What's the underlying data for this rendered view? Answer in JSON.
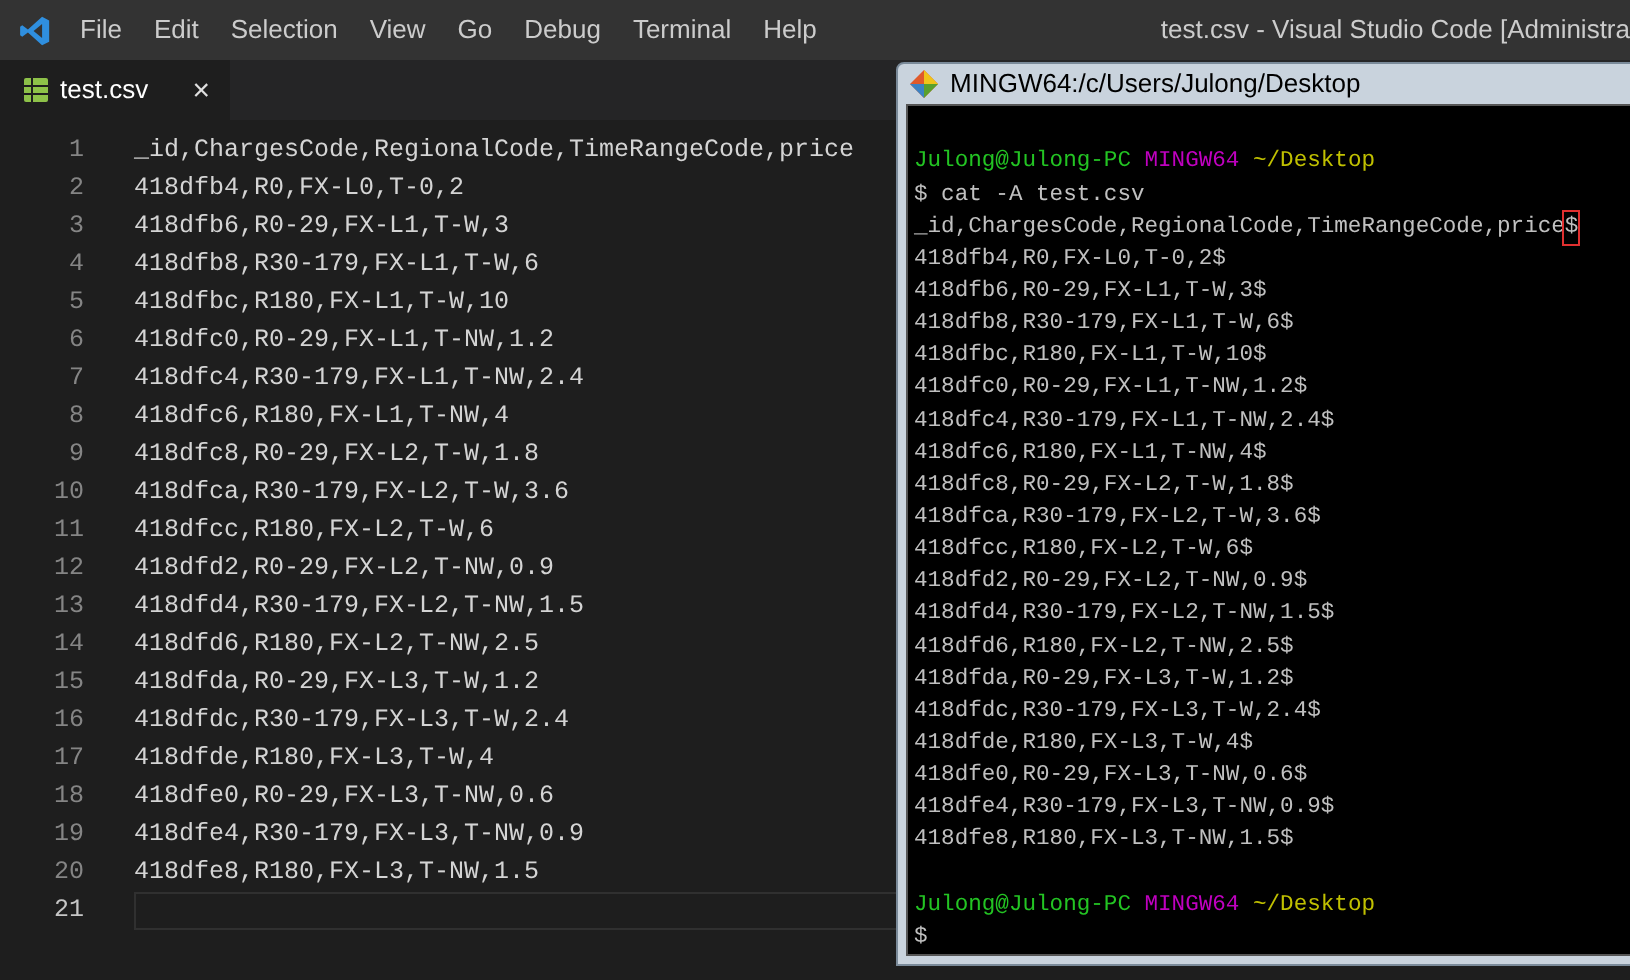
{
  "menu": [
    "File",
    "Edit",
    "Selection",
    "View",
    "Go",
    "Debug",
    "Terminal",
    "Help"
  ],
  "window": {
    "title": "test.csv - Visual Studio Code [Administra"
  },
  "tabs": [
    {
      "label": "test.csv",
      "selected": true,
      "close": "×"
    }
  ],
  "editor": {
    "lines": [
      {
        "number": "1",
        "text": "_id,ChargesCode,RegionalCode,TimeRangeCode,price",
        "selected": false
      },
      {
        "number": "2",
        "text": "418dfb4,R0,FX-L0,T-0,2",
        "selected": false
      },
      {
        "number": "3",
        "text": "418dfb6,R0-29,FX-L1,T-W,3",
        "selected": false
      },
      {
        "number": "4",
        "text": "418dfb8,R30-179,FX-L1,T-W,6",
        "selected": false
      },
      {
        "number": "5",
        "text": "418dfbc,R180,FX-L1,T-W,10",
        "selected": false
      },
      {
        "number": "6",
        "text": "418dfc0,R0-29,FX-L1,T-NW,1.2",
        "selected": false
      },
      {
        "number": "7",
        "text": "418dfc4,R30-179,FX-L1,T-NW,2.4",
        "selected": false
      },
      {
        "number": "8",
        "text": "418dfc6,R180,FX-L1,T-NW,4",
        "selected": false
      },
      {
        "number": "9",
        "text": "418dfc8,R0-29,FX-L2,T-W,1.8",
        "selected": false
      },
      {
        "number": "10",
        "text": "418dfca,R30-179,FX-L2,T-W,3.6",
        "selected": false
      },
      {
        "number": "11",
        "text": "418dfcc,R180,FX-L2,T-W,6",
        "selected": false
      },
      {
        "number": "12",
        "text": "418dfd2,R0-29,FX-L2,T-NW,0.9",
        "selected": false
      },
      {
        "number": "13",
        "text": "418dfd4,R30-179,FX-L2,T-NW,1.5",
        "selected": false
      },
      {
        "number": "14",
        "text": "418dfd6,R180,FX-L2,T-NW,2.5",
        "selected": false
      },
      {
        "number": "15",
        "text": "418dfda,R0-29,FX-L3,T-W,1.2",
        "selected": false
      },
      {
        "number": "16",
        "text": "418dfdc,R30-179,FX-L3,T-W,2.4",
        "selected": false
      },
      {
        "number": "17",
        "text": "418dfde,R180,FX-L3,T-W,4",
        "selected": false
      },
      {
        "number": "18",
        "text": "418dfe0,R0-29,FX-L3,T-NW,0.6",
        "selected": false
      },
      {
        "number": "19",
        "text": "418dfe4,R30-179,FX-L3,T-NW,0.9",
        "selected": false
      },
      {
        "number": "20",
        "text": "418dfe8,R180,FX-L3,T-NW,1.5",
        "selected": false
      },
      {
        "number": "21",
        "selected": true
      }
    ]
  },
  "terminal": {
    "title": "MINGW64:/c/Users/Julong/Desktop",
    "lines": [
      {
        "kind": "blank"
      },
      {
        "kind": "prompt",
        "user": "Julong@Julong-PC",
        "system": "MINGW64",
        "path": "~/Desktop"
      },
      {
        "kind": "output",
        "text": "$ cat -A test.csv"
      },
      {
        "kind": "marked",
        "text": "_id,ChargesCode,RegionalCode,TimeRangeCode,price",
        "marked": "$"
      },
      {
        "kind": "output",
        "text": "418dfb4,R0,FX-L0,T-0,2$"
      },
      {
        "kind": "output",
        "text": "418dfb6,R0-29,FX-L1,T-W,3$"
      },
      {
        "kind": "output",
        "text": "418dfb8,R30-179,FX-L1,T-W,6$"
      },
      {
        "kind": "output",
        "text": "418dfbc,R180,FX-L1,T-W,10$"
      },
      {
        "kind": "output",
        "text": "418dfc0,R0-29,FX-L1,T-NW,1.2$"
      },
      {
        "kind": "output",
        "text": "418dfc4,R30-179,FX-L1,T-NW,2.4$"
      },
      {
        "kind": "output",
        "text": "418dfc6,R180,FX-L1,T-NW,4$"
      },
      {
        "kind": "output",
        "text": "418dfc8,R0-29,FX-L2,T-W,1.8$"
      },
      {
        "kind": "output",
        "text": "418dfca,R30-179,FX-L2,T-W,3.6$"
      },
      {
        "kind": "output",
        "text": "418dfcc,R180,FX-L2,T-W,6$"
      },
      {
        "kind": "output",
        "text": "418dfd2,R0-29,FX-L2,T-NW,0.9$"
      },
      {
        "kind": "output",
        "text": "418dfd4,R30-179,FX-L2,T-NW,1.5$"
      },
      {
        "kind": "output",
        "text": "418dfd6,R180,FX-L2,T-NW,2.5$"
      },
      {
        "kind": "output",
        "text": "418dfda,R0-29,FX-L3,T-W,1.2$"
      },
      {
        "kind": "output",
        "text": "418dfdc,R30-179,FX-L3,T-W,2.4$"
      },
      {
        "kind": "output",
        "text": "418dfde,R180,FX-L3,T-W,4$"
      },
      {
        "kind": "output",
        "text": "418dfe0,R0-29,FX-L3,T-NW,0.6$"
      },
      {
        "kind": "output",
        "text": "418dfe4,R30-179,FX-L3,T-NW,0.9$"
      },
      {
        "kind": "output",
        "text": "418dfe8,R180,FX-L3,T-NW,1.5$"
      },
      {
        "kind": "blank"
      },
      {
        "kind": "prompt",
        "user": "Julong@Julong-PC",
        "system": "MINGW64",
        "path": "~/Desktop"
      },
      {
        "kind": "output",
        "text": "$"
      }
    ]
  }
}
